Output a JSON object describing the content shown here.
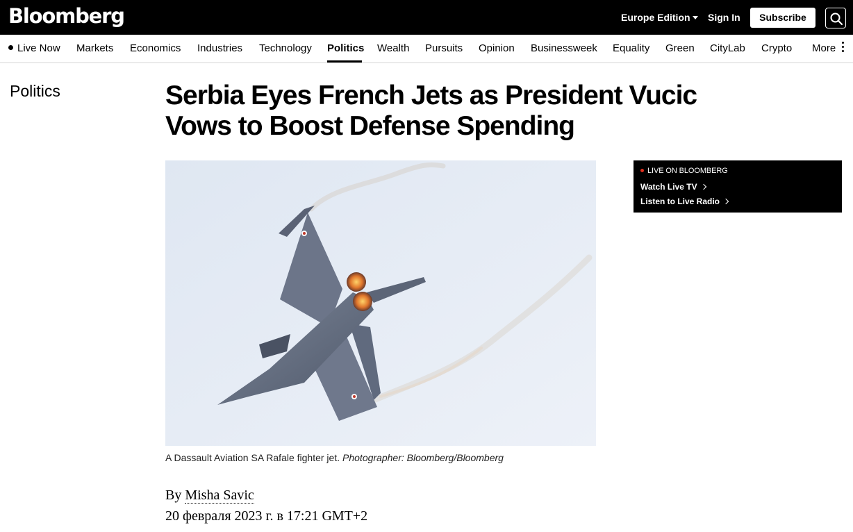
{
  "header": {
    "logo": "Bloomberg",
    "edition": "Europe Edition",
    "sign_in": "Sign In",
    "subscribe": "Subscribe",
    "search_icon": "search-icon"
  },
  "nav": {
    "items": [
      {
        "label": "Live Now"
      },
      {
        "label": "Markets"
      },
      {
        "label": "Economics"
      },
      {
        "label": "Industries"
      },
      {
        "label": "Technology"
      },
      {
        "label": "Politics",
        "active": true
      },
      {
        "label": "Wealth"
      },
      {
        "label": "Pursuits"
      },
      {
        "label": "Opinion"
      },
      {
        "label": "Businessweek"
      },
      {
        "label": "Equality"
      },
      {
        "label": "Green"
      },
      {
        "label": "CityLab"
      },
      {
        "label": "Crypto"
      },
      {
        "label": "More"
      }
    ]
  },
  "article": {
    "section": "Politics",
    "headline": "Serbia Eyes French Jets as President Vucic Vows to Boost Defense Spending",
    "image_caption": "A Dassault Aviation SA Rafale fighter jet.",
    "image_credit": "Photographer: Bloomberg/Bloomberg",
    "byline_prefix": "By",
    "author": "Misha Savic",
    "date": "20 февраля 2023 г. в 17:21 GMT+2"
  },
  "live": {
    "label": "LIVE ON BLOOMBERG",
    "watch": "Watch Live TV",
    "listen": "Listen to Live Radio"
  },
  "colors": {
    "topbar": "#000000",
    "live_dot": "#e0301e",
    "sky": "#e7edf6"
  }
}
